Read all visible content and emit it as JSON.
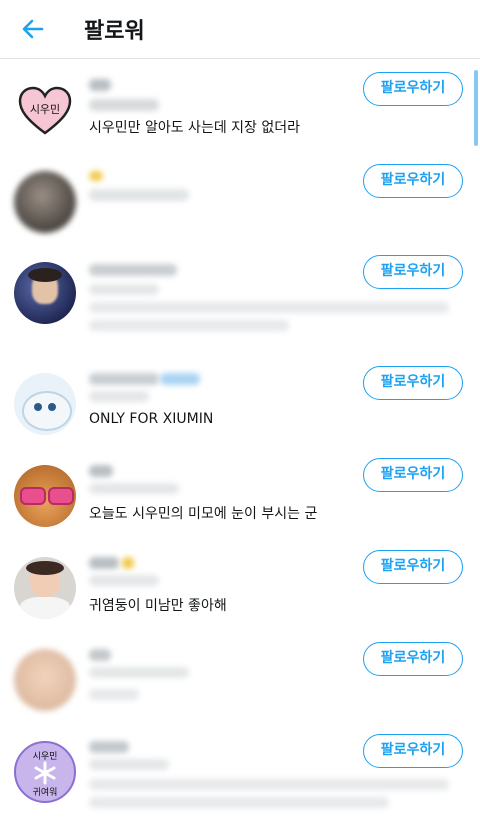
{
  "header": {
    "title": "팔로워"
  },
  "follow_label": "팔로우하기",
  "rows": [
    {
      "bio": "시우민만 알아도 사는데 지장 없더라",
      "avatar_text": "시우민"
    },
    {
      "bio": ""
    },
    {
      "bio": ""
    },
    {
      "bio": "ONLY FOR XIUMIN"
    },
    {
      "bio": "오늘도 시우민의 미모에 눈이 부시는 군"
    },
    {
      "bio": "귀염둥이 미남만 좋아해"
    },
    {
      "bio": ""
    },
    {
      "bio": "",
      "avatar_text_top": "시우민",
      "avatar_text_bottom": "귀여워"
    }
  ],
  "colors": {
    "accent": "#1da1f2",
    "divider": "#e3e6e8"
  }
}
